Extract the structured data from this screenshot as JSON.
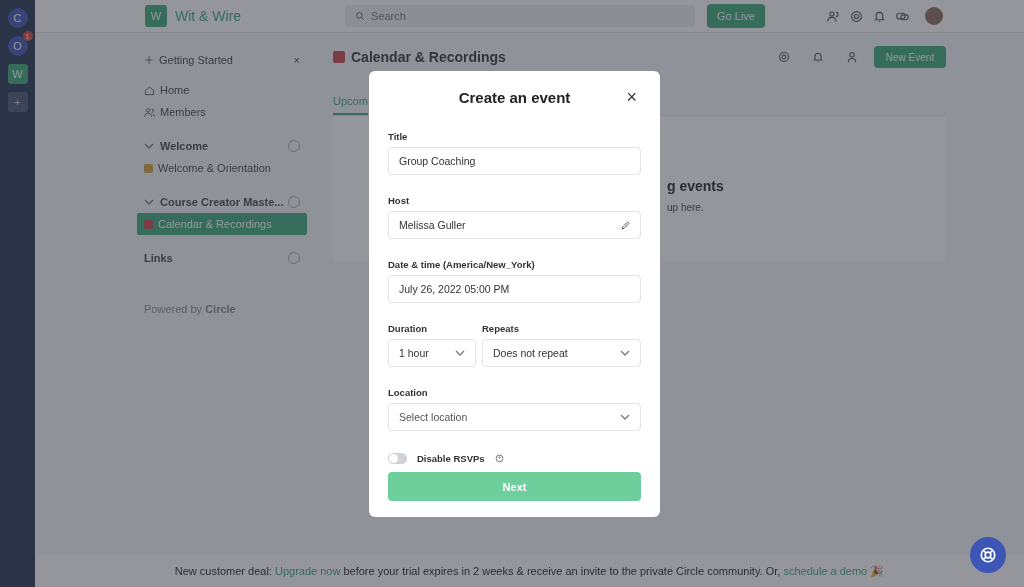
{
  "rail": {
    "items": [
      {
        "kind": "avatar",
        "label": "C"
      },
      {
        "kind": "avatar",
        "label": "O",
        "badge": "1"
      },
      {
        "kind": "community",
        "label": "W"
      },
      {
        "kind": "add",
        "label": "+"
      }
    ]
  },
  "header": {
    "logo_letter": "W",
    "brand": "Wit & Wire",
    "search": {
      "placeholder": "Search"
    },
    "go_live": "Go Live"
  },
  "sidebar": {
    "getting_started": "Getting Started",
    "close": "×",
    "nav": [
      {
        "label": "Home",
        "kind": "home"
      },
      {
        "label": "Members",
        "kind": "members"
      }
    ],
    "groups": [
      {
        "title": "Welcome",
        "expanded": true,
        "items": [
          {
            "label": "Welcome & Orientation",
            "selected": false
          }
        ]
      },
      {
        "title": "Course Creator Maste...",
        "expanded": true,
        "items": [
          {
            "label": "Calendar & Recordings",
            "selected": true
          }
        ]
      }
    ],
    "links": "Links",
    "powered": "Powered by **Circle**"
  },
  "content": {
    "title": "Calendar & Recordings",
    "tabs": [
      {
        "label": "Upcom",
        "selected": true
      }
    ],
    "new_event": "New Event",
    "empty_title": "g events",
    "empty_text": "up here."
  },
  "modal": {
    "title": "Create an event",
    "close": "×",
    "title_field": {
      "label": "Title",
      "value": "Group Coaching"
    },
    "host": {
      "label": "Host",
      "value": "Melissa Guller"
    },
    "datetime": {
      "label": "Date & time (America/New_York)",
      "value": "July 26, 2022 05:00 PM"
    },
    "duration": {
      "label": "Duration",
      "value": "1 hour"
    },
    "repeats": {
      "label": "Repeats",
      "value": "Does not repeat"
    },
    "location": {
      "label": "Location",
      "placeholder": "Select location"
    },
    "rsvp": {
      "label": "Disable RSVPs",
      "on": false
    },
    "next": "Next"
  },
  "banner": {
    "parts": [
      {
        "kind": "text",
        "text": "New customer deal: "
      },
      {
        "kind": "link",
        "text": "Upgrade now"
      },
      {
        "kind": "text",
        "text": " before your trial expires in 2 weeks & receive an invite to the private Circle community. Or, "
      },
      {
        "kind": "link",
        "text": "schedule a demo"
      },
      {
        "kind": "text",
        "text": " 🎉"
      }
    ]
  }
}
